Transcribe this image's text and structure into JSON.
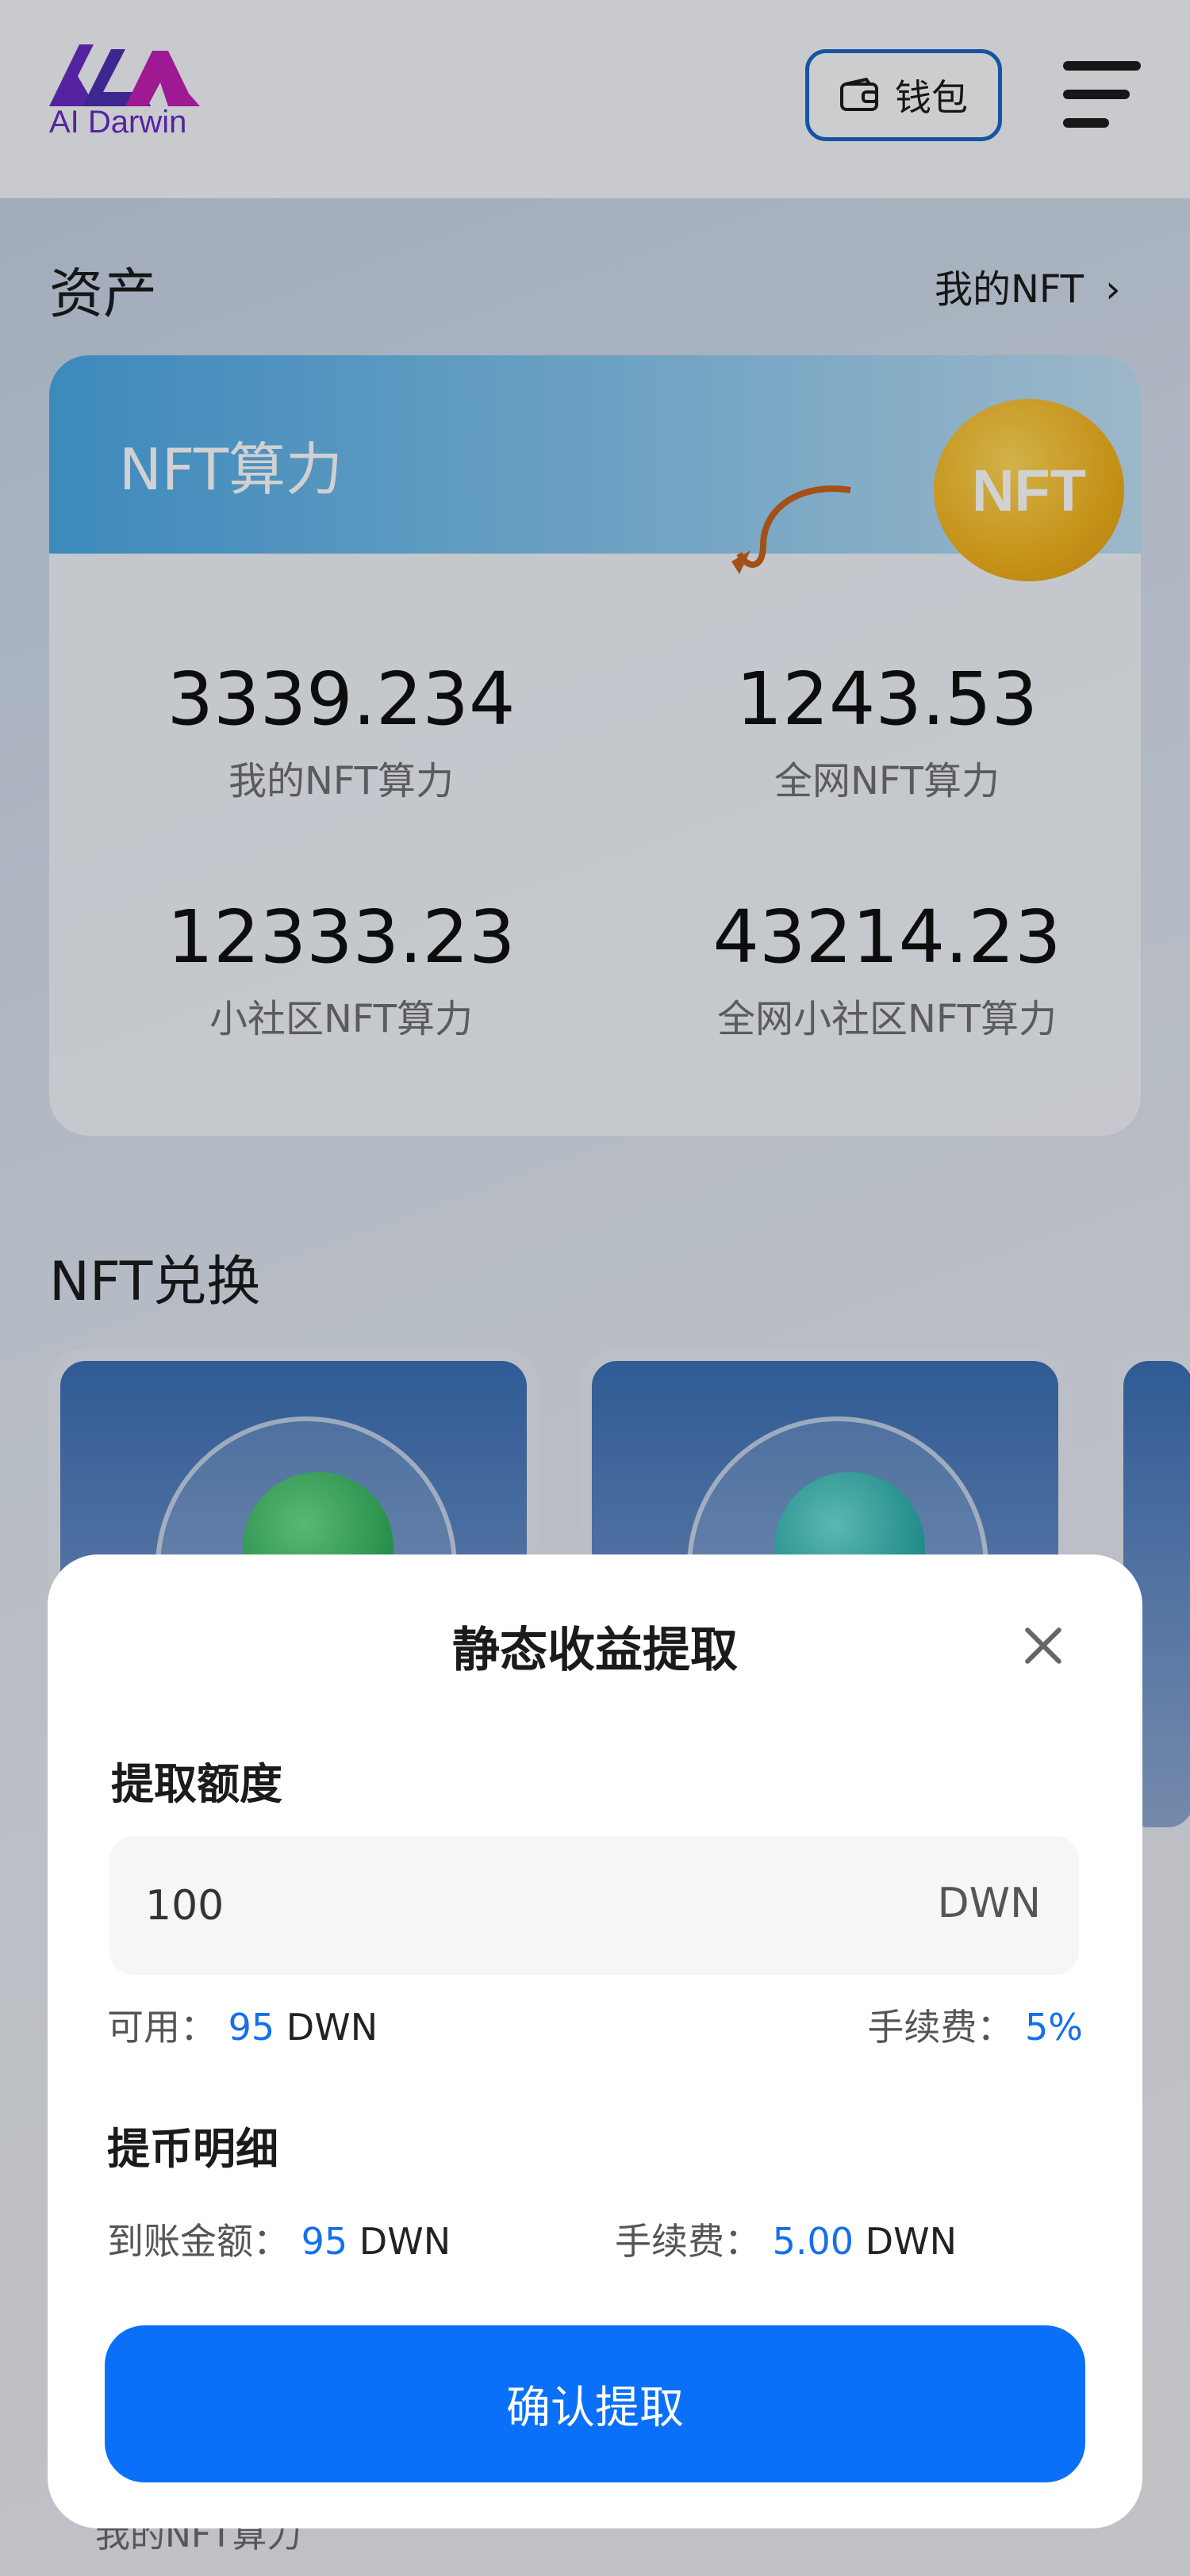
{
  "header": {
    "logo_text": "AI Darwin",
    "wallet_label": "钱包"
  },
  "assets": {
    "title": "资产",
    "my_nft_link": "我的NFT",
    "banner_title": "NFT算力",
    "coin_label": "NFT",
    "stats": [
      {
        "value": "3339.234",
        "label": "我的NFT算力"
      },
      {
        "value": "1243.53",
        "label": "全网NFT算力"
      },
      {
        "value": "12333.23",
        "label": "小社区NFT算力"
      },
      {
        "value": "43214.23",
        "label": "全网小社区NFT算力"
      }
    ]
  },
  "exchange": {
    "title": "NFT兑换",
    "peek_label": "我的NFT算力"
  },
  "modal": {
    "title": "静态收益提取",
    "amount_label": "提取额度",
    "amount_value": "100",
    "amount_unit": "DWN",
    "available_label": "可用：",
    "available_value": "95",
    "available_unit": "DWN",
    "fee_label": "手续费：",
    "fee_value": "5%",
    "detail_title": "提币明细",
    "received_label": "到账金额：",
    "received_value": "95",
    "received_unit": "DWN",
    "detail_fee_label": "手续费：",
    "detail_fee_value": "5.00",
    "detail_fee_unit": "DWN",
    "confirm_label": "确认提取"
  },
  "colors": {
    "primary": "#0a70fa",
    "accent_blue": "#1570e8",
    "wallet_border": "#1d67c9"
  }
}
